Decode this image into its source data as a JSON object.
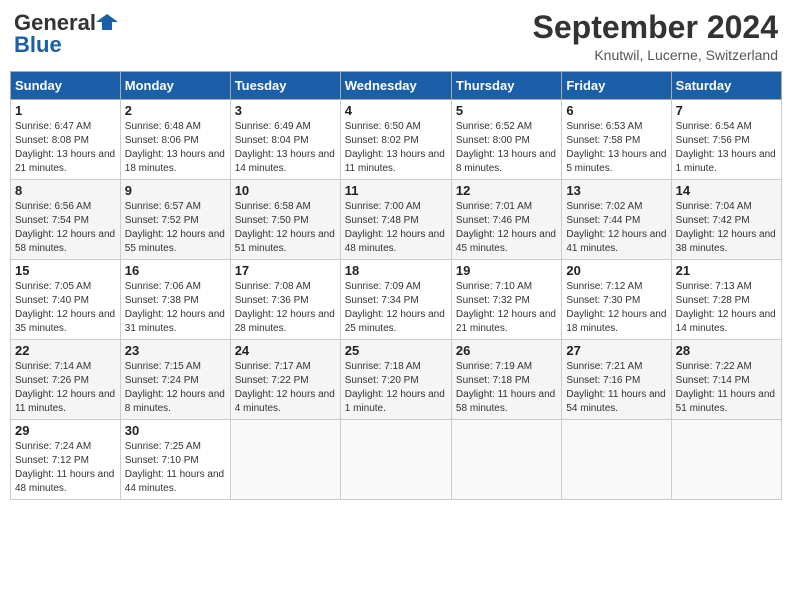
{
  "header": {
    "logo_line1": "General",
    "logo_line2": "Blue",
    "month_title": "September 2024",
    "location": "Knutwil, Lucerne, Switzerland"
  },
  "days_of_week": [
    "Sunday",
    "Monday",
    "Tuesday",
    "Wednesday",
    "Thursday",
    "Friday",
    "Saturday"
  ],
  "weeks": [
    [
      {
        "day": "1",
        "sunrise": "Sunrise: 6:47 AM",
        "sunset": "Sunset: 8:08 PM",
        "daylight": "Daylight: 13 hours and 21 minutes."
      },
      {
        "day": "2",
        "sunrise": "Sunrise: 6:48 AM",
        "sunset": "Sunset: 8:06 PM",
        "daylight": "Daylight: 13 hours and 18 minutes."
      },
      {
        "day": "3",
        "sunrise": "Sunrise: 6:49 AM",
        "sunset": "Sunset: 8:04 PM",
        "daylight": "Daylight: 13 hours and 14 minutes."
      },
      {
        "day": "4",
        "sunrise": "Sunrise: 6:50 AM",
        "sunset": "Sunset: 8:02 PM",
        "daylight": "Daylight: 13 hours and 11 minutes."
      },
      {
        "day": "5",
        "sunrise": "Sunrise: 6:52 AM",
        "sunset": "Sunset: 8:00 PM",
        "daylight": "Daylight: 13 hours and 8 minutes."
      },
      {
        "day": "6",
        "sunrise": "Sunrise: 6:53 AM",
        "sunset": "Sunset: 7:58 PM",
        "daylight": "Daylight: 13 hours and 5 minutes."
      },
      {
        "day": "7",
        "sunrise": "Sunrise: 6:54 AM",
        "sunset": "Sunset: 7:56 PM",
        "daylight": "Daylight: 13 hours and 1 minute."
      }
    ],
    [
      {
        "day": "8",
        "sunrise": "Sunrise: 6:56 AM",
        "sunset": "Sunset: 7:54 PM",
        "daylight": "Daylight: 12 hours and 58 minutes."
      },
      {
        "day": "9",
        "sunrise": "Sunrise: 6:57 AM",
        "sunset": "Sunset: 7:52 PM",
        "daylight": "Daylight: 12 hours and 55 minutes."
      },
      {
        "day": "10",
        "sunrise": "Sunrise: 6:58 AM",
        "sunset": "Sunset: 7:50 PM",
        "daylight": "Daylight: 12 hours and 51 minutes."
      },
      {
        "day": "11",
        "sunrise": "Sunrise: 7:00 AM",
        "sunset": "Sunset: 7:48 PM",
        "daylight": "Daylight: 12 hours and 48 minutes."
      },
      {
        "day": "12",
        "sunrise": "Sunrise: 7:01 AM",
        "sunset": "Sunset: 7:46 PM",
        "daylight": "Daylight: 12 hours and 45 minutes."
      },
      {
        "day": "13",
        "sunrise": "Sunrise: 7:02 AM",
        "sunset": "Sunset: 7:44 PM",
        "daylight": "Daylight: 12 hours and 41 minutes."
      },
      {
        "day": "14",
        "sunrise": "Sunrise: 7:04 AM",
        "sunset": "Sunset: 7:42 PM",
        "daylight": "Daylight: 12 hours and 38 minutes."
      }
    ],
    [
      {
        "day": "15",
        "sunrise": "Sunrise: 7:05 AM",
        "sunset": "Sunset: 7:40 PM",
        "daylight": "Daylight: 12 hours and 35 minutes."
      },
      {
        "day": "16",
        "sunrise": "Sunrise: 7:06 AM",
        "sunset": "Sunset: 7:38 PM",
        "daylight": "Daylight: 12 hours and 31 minutes."
      },
      {
        "day": "17",
        "sunrise": "Sunrise: 7:08 AM",
        "sunset": "Sunset: 7:36 PM",
        "daylight": "Daylight: 12 hours and 28 minutes."
      },
      {
        "day": "18",
        "sunrise": "Sunrise: 7:09 AM",
        "sunset": "Sunset: 7:34 PM",
        "daylight": "Daylight: 12 hours and 25 minutes."
      },
      {
        "day": "19",
        "sunrise": "Sunrise: 7:10 AM",
        "sunset": "Sunset: 7:32 PM",
        "daylight": "Daylight: 12 hours and 21 minutes."
      },
      {
        "day": "20",
        "sunrise": "Sunrise: 7:12 AM",
        "sunset": "Sunset: 7:30 PM",
        "daylight": "Daylight: 12 hours and 18 minutes."
      },
      {
        "day": "21",
        "sunrise": "Sunrise: 7:13 AM",
        "sunset": "Sunset: 7:28 PM",
        "daylight": "Daylight: 12 hours and 14 minutes."
      }
    ],
    [
      {
        "day": "22",
        "sunrise": "Sunrise: 7:14 AM",
        "sunset": "Sunset: 7:26 PM",
        "daylight": "Daylight: 12 hours and 11 minutes."
      },
      {
        "day": "23",
        "sunrise": "Sunrise: 7:15 AM",
        "sunset": "Sunset: 7:24 PM",
        "daylight": "Daylight: 12 hours and 8 minutes."
      },
      {
        "day": "24",
        "sunrise": "Sunrise: 7:17 AM",
        "sunset": "Sunset: 7:22 PM",
        "daylight": "Daylight: 12 hours and 4 minutes."
      },
      {
        "day": "25",
        "sunrise": "Sunrise: 7:18 AM",
        "sunset": "Sunset: 7:20 PM",
        "daylight": "Daylight: 12 hours and 1 minute."
      },
      {
        "day": "26",
        "sunrise": "Sunrise: 7:19 AM",
        "sunset": "Sunset: 7:18 PM",
        "daylight": "Daylight: 11 hours and 58 minutes."
      },
      {
        "day": "27",
        "sunrise": "Sunrise: 7:21 AM",
        "sunset": "Sunset: 7:16 PM",
        "daylight": "Daylight: 11 hours and 54 minutes."
      },
      {
        "day": "28",
        "sunrise": "Sunrise: 7:22 AM",
        "sunset": "Sunset: 7:14 PM",
        "daylight": "Daylight: 11 hours and 51 minutes."
      }
    ],
    [
      {
        "day": "29",
        "sunrise": "Sunrise: 7:24 AM",
        "sunset": "Sunset: 7:12 PM",
        "daylight": "Daylight: 11 hours and 48 minutes."
      },
      {
        "day": "30",
        "sunrise": "Sunrise: 7:25 AM",
        "sunset": "Sunset: 7:10 PM",
        "daylight": "Daylight: 11 hours and 44 minutes."
      },
      null,
      null,
      null,
      null,
      null
    ]
  ]
}
